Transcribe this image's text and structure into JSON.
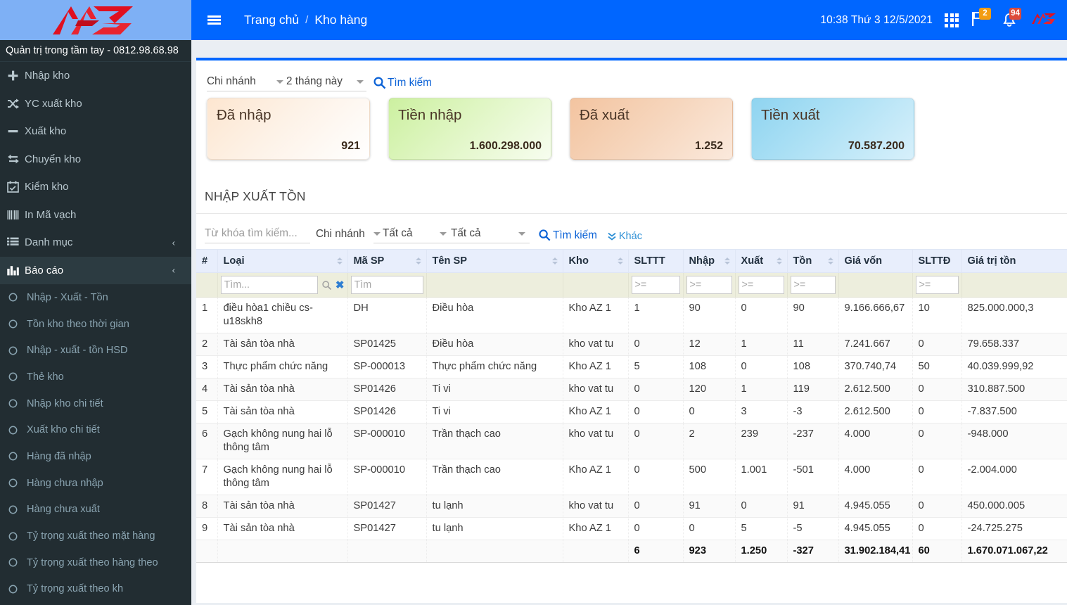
{
  "brand": {
    "tagline": "Quản trị trong tầm tay - 0812.98.68.98",
    "logo_alt": "AZ"
  },
  "sidebar": {
    "items": [
      {
        "label": "Nhập kho",
        "icon": "plus-icon",
        "chevron": ""
      },
      {
        "label": "YC xuất kho",
        "icon": "shuffle-icon",
        "chevron": ""
      },
      {
        "label": "Xuất kho",
        "icon": "minus-icon",
        "chevron": ""
      },
      {
        "label": "Chuyển kho",
        "icon": "exchange-icon",
        "chevron": ""
      },
      {
        "label": "Kiểm kho",
        "icon": "calendar-check-icon",
        "chevron": ""
      },
      {
        "label": "In Mã vạch",
        "icon": "barcode-icon",
        "chevron": ""
      },
      {
        "label": "Danh mục",
        "icon": "list-icon",
        "chevron": "‹"
      },
      {
        "label": "Báo cáo",
        "icon": "bar-chart-icon",
        "chevron": "‹"
      }
    ],
    "report_items": [
      {
        "label": "Nhập - Xuất - Tồn"
      },
      {
        "label": "Tồn kho theo thời gian"
      },
      {
        "label": "Nhập - xuất - tồn HSD"
      },
      {
        "label": "Thẻ kho"
      },
      {
        "label": "Nhập kho chi tiết"
      },
      {
        "label": "Xuất kho chi tiết"
      },
      {
        "label": "Hàng đã nhập"
      },
      {
        "label": "Hàng chưa nhập"
      },
      {
        "label": "Hàng chưa xuất"
      },
      {
        "label": "Tỷ trọng xuất theo mặt hàng"
      },
      {
        "label": "Tỷ trọng xuất theo hàng theo"
      },
      {
        "label": "Tỷ trọng xuất theo kh"
      }
    ]
  },
  "header": {
    "breadcrumb_home": "Trang chủ",
    "breadcrumb_sep": "/",
    "breadcrumb_current": "Kho hàng",
    "clock": "10:38  Thứ 3 12/5/2021",
    "flag_badge": "2",
    "bell_badge": "94"
  },
  "topfilter": {
    "branch_value": "Chi nhánh",
    "period_value": "2 tháng này",
    "search_label": "Tìm kiếm"
  },
  "cards": [
    {
      "title": "Đã nhập",
      "value": "921",
      "color": "#fde6d0"
    },
    {
      "title": "Tiền nhập",
      "value": "1.600.298.000",
      "color": "#ccf0a0"
    },
    {
      "title": "Đã xuất",
      "value": "1.252",
      "color": "#f3c4a0"
    },
    {
      "title": "Tiền xuất",
      "value": "70.587.200",
      "color": "#8fd4f0"
    }
  ],
  "section": {
    "title": "NHẬP XUẤT TỒN"
  },
  "filter2": {
    "keyword_placeholder": "Từ khóa tìm kiếm...",
    "branch_label": "Chi nhánh",
    "select_all_1": "Tất cả",
    "select_all_2": "Tất cả",
    "search_label": "Tìm kiếm",
    "more_label": "Khác"
  },
  "table": {
    "columns": [
      {
        "key": "idx",
        "label": "#",
        "sortable": false
      },
      {
        "key": "loai",
        "label": "Loại",
        "sortable": true
      },
      {
        "key": "masp",
        "label": "Mã SP",
        "sortable": true
      },
      {
        "key": "tensp",
        "label": "Tên SP",
        "sortable": true
      },
      {
        "key": "kho",
        "label": "Kho",
        "sortable": true
      },
      {
        "key": "slttt",
        "label": "SLTTT",
        "sortable": false
      },
      {
        "key": "nhap",
        "label": "Nhập",
        "sortable": true
      },
      {
        "key": "xuat",
        "label": "Xuất",
        "sortable": true
      },
      {
        "key": "ton",
        "label": "Tồn",
        "sortable": true
      },
      {
        "key": "giavon",
        "label": "Giá vốn",
        "sortable": false
      },
      {
        "key": "slttd",
        "label": "SLTTĐ",
        "sortable": false
      },
      {
        "key": "gttt",
        "label": "Giá trị tồn",
        "sortable": false
      }
    ],
    "filter_row": {
      "loai_placeholder": "Tìm...",
      "masp_placeholder": "Tìm",
      "tensp_placeholder": "",
      "kho_placeholder": "",
      "slttt_placeholder": ">=",
      "nhap_placeholder": ">=",
      "xuat_placeholder": ">=",
      "ton_placeholder": ">=",
      "giavon_placeholder": "",
      "slttd_placeholder": ">=",
      "gttt_placeholder": ""
    },
    "rows": [
      {
        "idx": "1",
        "loai": "điều hòa1 chiều cs-u18skh8",
        "masp": "DH",
        "tensp": "Điều hòa",
        "kho": "Kho AZ 1",
        "slttt": "1",
        "nhap": "90",
        "xuat": "0",
        "ton": "90",
        "giavon": "9.166.666,67",
        "slttd": "10",
        "gttt": "825.000.000,3"
      },
      {
        "idx": "2",
        "loai": "Tài sản tòa nhà",
        "masp": "SP01425",
        "tensp": "Điều hòa",
        "kho": "kho vat tu",
        "slttt": "0",
        "nhap": "12",
        "xuat": "1",
        "ton": "11",
        "giavon": "7.241.667",
        "slttd": "0",
        "gttt": "79.658.337"
      },
      {
        "idx": "3",
        "loai": "Thực phẩm chức năng",
        "masp": "SP-000013",
        "tensp": "Thực phẩm chức năng",
        "kho": "Kho AZ 1",
        "slttt": "5",
        "nhap": "108",
        "xuat": "0",
        "ton": "108",
        "giavon": "370.740,74",
        "slttd": "50",
        "gttt": "40.039.999,92"
      },
      {
        "idx": "4",
        "loai": "Tài sản tòa nhà",
        "masp": "SP01426",
        "tensp": "Ti vi",
        "kho": "kho vat tu",
        "slttt": "0",
        "nhap": "120",
        "xuat": "1",
        "ton": "119",
        "giavon": "2.612.500",
        "slttd": "0",
        "gttt": "310.887.500"
      },
      {
        "idx": "5",
        "loai": "Tài sản tòa nhà",
        "masp": "SP01426",
        "tensp": "Ti vi",
        "kho": "Kho AZ 1",
        "slttt": "0",
        "nhap": "0",
        "xuat": "3",
        "ton": "-3",
        "giavon": "2.612.500",
        "slttd": "0",
        "gttt": "-7.837.500"
      },
      {
        "idx": "6",
        "loai": "Gạch không nung hai lỗ thông tâm",
        "masp": "SP-000010",
        "tensp": "Trần thạch cao",
        "kho": "kho vat tu",
        "slttt": "0",
        "nhap": "2",
        "xuat": "239",
        "ton": "-237",
        "giavon": "4.000",
        "slttd": "0",
        "gttt": "-948.000"
      },
      {
        "idx": "7",
        "loai": "Gạch không nung hai lỗ thông tâm",
        "masp": "SP-000010",
        "tensp": "Trần thạch cao",
        "kho": "Kho AZ 1",
        "slttt": "0",
        "nhap": "500",
        "xuat": "1.001",
        "ton": "-501",
        "giavon": "4.000",
        "slttd": "0",
        "gttt": "-2.004.000"
      },
      {
        "idx": "8",
        "loai": "Tài sản tòa nhà",
        "masp": "SP01427",
        "tensp": "tu lạnh",
        "kho": "kho vat tu",
        "slttt": "0",
        "nhap": "91",
        "xuat": "0",
        "ton": "91",
        "giavon": "4.945.055",
        "slttd": "0",
        "gttt": "450.000.005"
      },
      {
        "idx": "9",
        "loai": "Tài sản tòa nhà",
        "masp": "SP01427",
        "tensp": "tu lạnh",
        "kho": "Kho AZ 1",
        "slttt": "0",
        "nhap": "0",
        "xuat": "5",
        "ton": "-5",
        "giavon": "4.945.055",
        "slttd": "0",
        "gttt": "-24.725.275"
      }
    ],
    "totals": {
      "idx": "",
      "loai": "",
      "masp": "",
      "tensp": "",
      "kho": "",
      "slttt": "6",
      "nhap": "923",
      "xuat": "1.250",
      "ton": "-327",
      "giavon": "31.902.184,41",
      "slttd": "60",
      "gttt": "1.670.071.067,22"
    }
  }
}
